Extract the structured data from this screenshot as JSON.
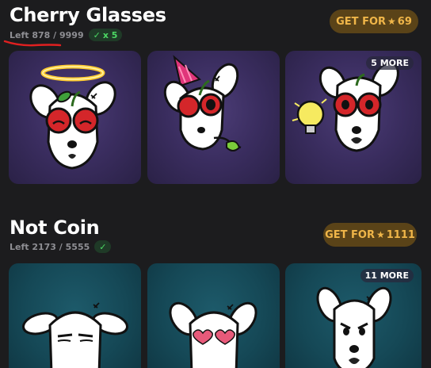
{
  "collections": [
    {
      "title": "Cherry Glasses",
      "left_text": "Left 878 / 9999",
      "owned_count": "x 5",
      "button_prefix": "GET FOR",
      "price": "69",
      "more_label": "5 MORE",
      "card_style": "purple",
      "items": [
        {
          "name": "halo-cherry-glasses-dog"
        },
        {
          "name": "party-hat-cherry-glasses-dog"
        },
        {
          "name": "lightbulb-cherry-glasses-dog"
        }
      ]
    },
    {
      "title": "Not Coin",
      "left_text": "Left 2173 / 5555",
      "owned_count": "",
      "button_prefix": "GET FOR",
      "price": "1111",
      "more_label": "11 MORE",
      "card_style": "teal",
      "items": [
        {
          "name": "sleepy-dog"
        },
        {
          "name": "heart-eyes-dog"
        },
        {
          "name": "angry-dog"
        }
      ]
    }
  ],
  "colors": {
    "background": "#1c1c1e",
    "button_bg": "#5a4318",
    "button_text": "#f0b649",
    "owned_green": "#4cd964",
    "annotation_red": "#e02020"
  },
  "icons": [
    "check-icon",
    "star-icon"
  ]
}
